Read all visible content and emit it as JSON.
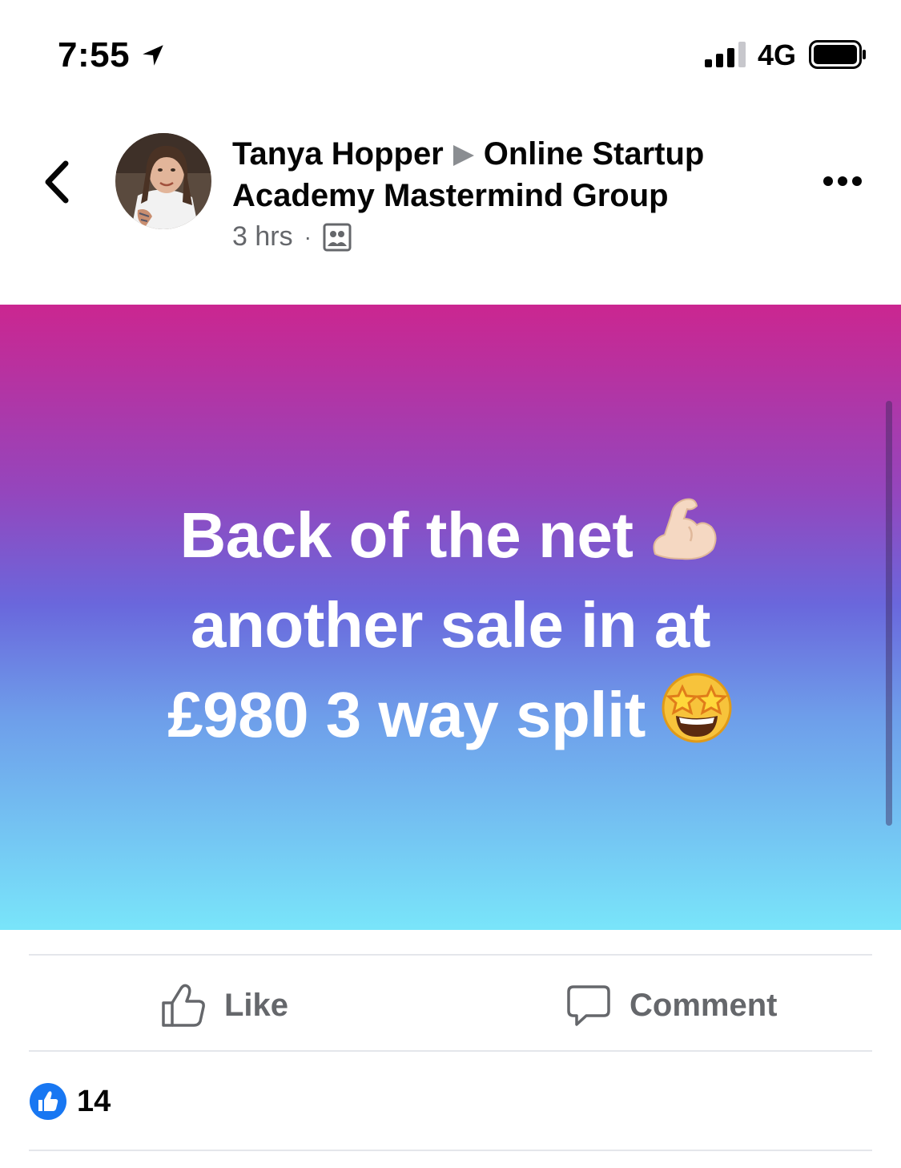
{
  "status_bar": {
    "time": "7:55",
    "network": "4G",
    "icons": [
      "location-arrow-icon",
      "signal-bars-icon",
      "battery-icon"
    ]
  },
  "post": {
    "author": "Tanya Hopper",
    "group": "Online Startup Academy Mastermind Group",
    "timestamp": "3 hrs",
    "dot": "·",
    "audience_icon": "group-audience-icon",
    "text": "Back of the net",
    "text_line2": "another sale in at",
    "text_line3": "£980 3 way split",
    "emojis": [
      "flexed-biceps-emoji",
      "star-struck-emoji"
    ],
    "background_gradient": [
      "#cb2690",
      "#6a67dc",
      "#79e5fa"
    ]
  },
  "actions": {
    "like_label": "Like",
    "comment_label": "Comment"
  },
  "reactions": {
    "count": "14",
    "badge_color": "#1877f2"
  },
  "colors": {
    "text_secondary": "#65676b",
    "divider": "#e4e6eb"
  }
}
